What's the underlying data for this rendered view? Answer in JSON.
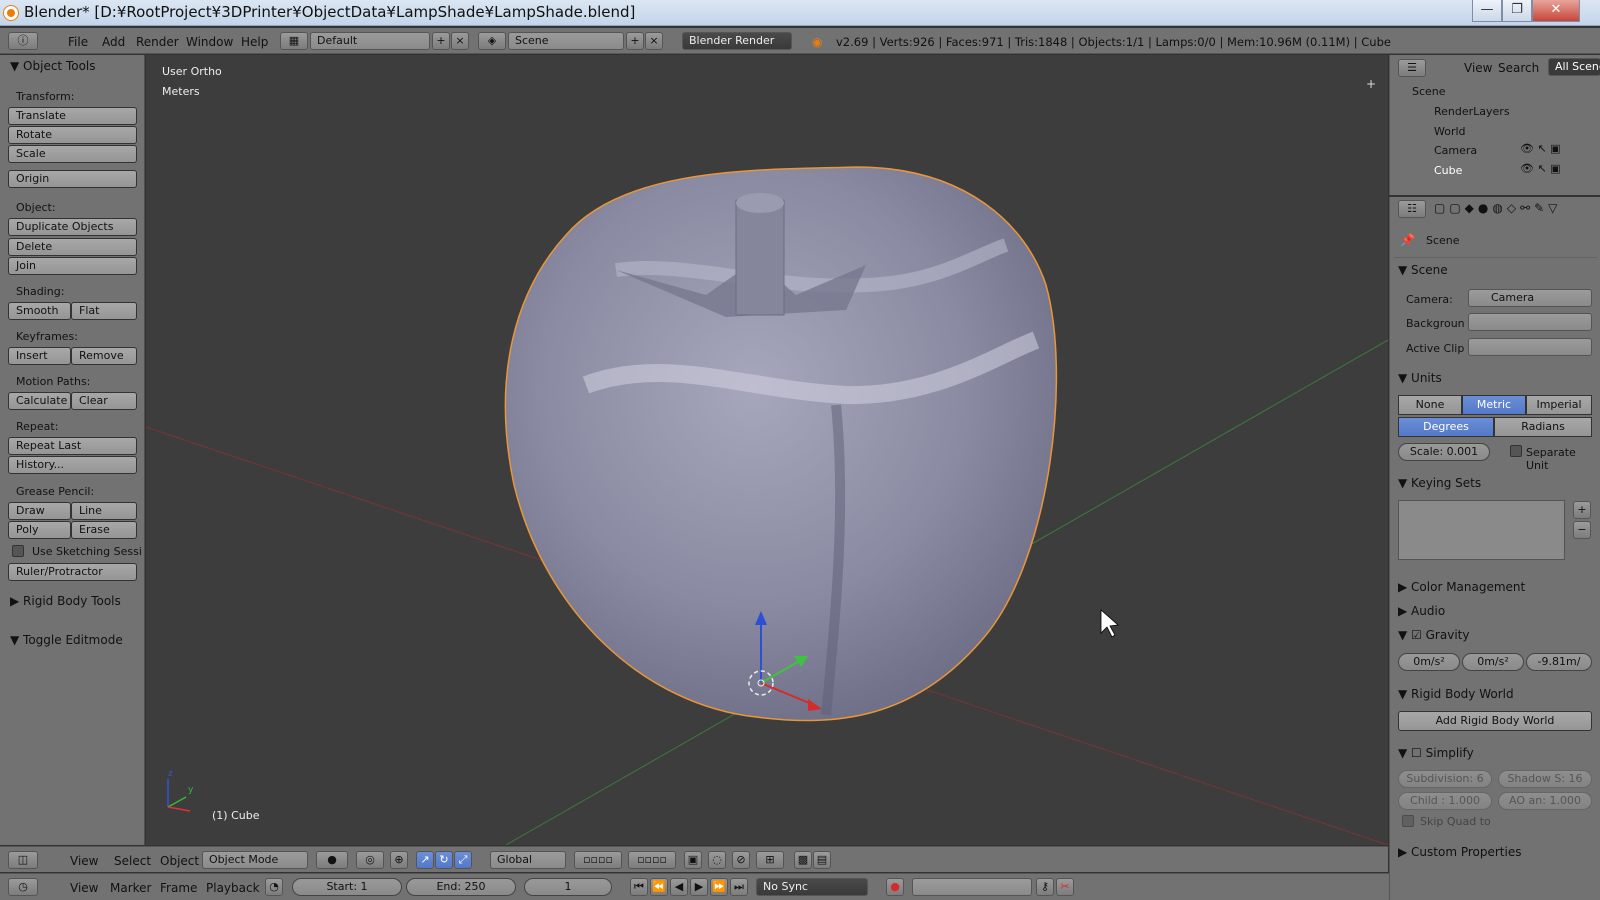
{
  "window": {
    "title": "Blender* [D:¥RootProject¥3DPrinter¥ObjectData¥LampShade¥LampShade.blend]",
    "min": "—",
    "max": "❐",
    "close": "✕"
  },
  "menu": {
    "items": [
      "File",
      "Add",
      "Render",
      "Window",
      "Help"
    ],
    "layout": "Default",
    "scene": "Scene",
    "engine": "Blender Render",
    "stats": "v2.69 | Verts:926 | Faces:971 | Tris:1848 | Objects:1/1 | Lamps:0/0 | Mem:10.96M (0.11M) | Cube"
  },
  "tools": {
    "header": "Object Tools",
    "transform": "Transform:",
    "translate": "Translate",
    "rotate": "Rotate",
    "scale": "Scale",
    "origin": "Origin",
    "object": "Object:",
    "duplicate": "Duplicate Objects",
    "delete": "Delete",
    "join": "Join",
    "shading": "Shading:",
    "smooth": "Smooth",
    "flat": "Flat",
    "keyframes": "Keyframes:",
    "insert": "Insert",
    "remove": "Remove",
    "motion": "Motion Paths:",
    "calculate": "Calculate",
    "clear": "Clear",
    "repeat": "Repeat:",
    "repeat_last": "Repeat Last",
    "history": "History...",
    "grease": "Grease Pencil:",
    "draw": "Draw",
    "line": "Line",
    "poly": "Poly",
    "erase": "Erase",
    "sketch": "Use Sketching Sessi",
    "ruler": "Ruler/Protractor",
    "rigid": "Rigid Body Tools",
    "toggle_edit": "Toggle Editmode"
  },
  "viewport": {
    "view": "User Ortho",
    "units": "Meters",
    "object": "(1) Cube"
  },
  "bottom": {
    "view": "View",
    "select": "Select",
    "object": "Object",
    "mode": "Object Mode",
    "orientation": "Global"
  },
  "timeline": {
    "view": "View",
    "marker": "Marker",
    "frame": "Frame",
    "playback": "Playback",
    "start": "Start: 1",
    "end": "End: 250",
    "current": "1",
    "sync": "No Sync"
  },
  "outliner": {
    "view": "View",
    "search": "Search",
    "filter": "All Scene",
    "items": [
      "Scene",
      "RenderLayers",
      "World",
      "Camera",
      "Cube"
    ]
  },
  "props": {
    "context": "Scene",
    "scene_section": "Scene",
    "camera_label": "Camera:",
    "camera_value": "Camera",
    "background_label": "Backgroun",
    "clip_label": "Active Clip",
    "units": "Units",
    "none": "None",
    "metric": "Metric",
    "imperial": "Imperial",
    "degrees": "Degrees",
    "radians": "Radians",
    "scale": "Scale: 0.001",
    "separate": "Separate Unit",
    "keying": "Keying Sets",
    "color": "Color Management",
    "audio": "Audio",
    "gravity": "Gravity",
    "gx": "0m/s²",
    "gy": "0m/s²",
    "gz": "-9.81m/",
    "rigid_world": "Rigid Body World",
    "add_rigid": "Add Rigid Body World",
    "simplify": "Simplify",
    "subdiv": "Subdivision: 6",
    "shadow": "Shadow S: 16",
    "child": "Child : 1.000",
    "ao": "AO an: 1.000",
    "skip_quad": "Skip Quad to",
    "custom": "Custom Properties"
  }
}
